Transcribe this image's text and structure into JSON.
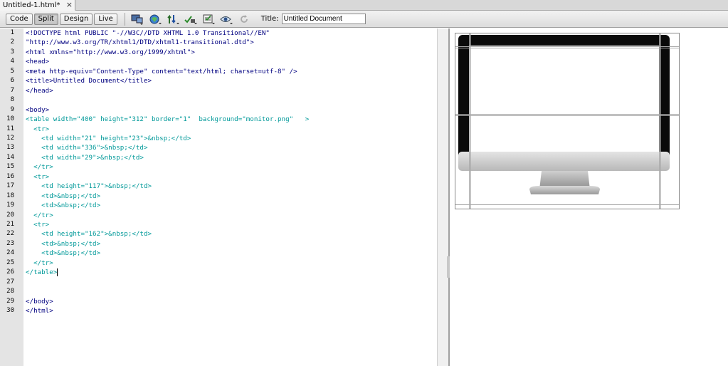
{
  "tab": {
    "label": "Untitled-1.html*",
    "close": "×"
  },
  "toolbar": {
    "views": [
      "Code",
      "Split",
      "Design",
      "Live"
    ],
    "active_view": "Split",
    "icons": [
      "multiscreen-icon",
      "preview-browser-icon",
      "file-management-icon",
      "w3c-validation-icon",
      "check-browser-compat-icon",
      "visual-aids-icon",
      "refresh-icon"
    ],
    "title_label": "Title:",
    "title_value": "Untitled Document"
  },
  "code": {
    "line_numbers": [
      "1",
      "2",
      "3",
      "4",
      "5",
      "6",
      "7",
      "8",
      "9",
      "10",
      "11",
      "12",
      "13",
      "14",
      "15",
      "16",
      "17",
      "18",
      "19",
      "20",
      "21",
      "22",
      "23",
      "24",
      "25",
      "26",
      "27",
      "28",
      "29",
      "30"
    ],
    "lines": [
      "<!DOCTYPE html PUBLIC \"-//W3C//DTD XHTML 1.0 Transitional//EN\"",
      "\"http://www.w3.org/TR/xhtml1/DTD/xhtml1-transitional.dtd\">",
      "<html xmlns=\"http://www.w3.org/1999/xhtml\">",
      "<head>",
      "<meta http-equiv=\"Content-Type\" content=\"text/html; charset=utf-8\" />",
      "<title>Untitled Document</title>",
      "</head>",
      "",
      "<body>",
      "<table width=\"400\" height=\"312\" border=\"1\"  background=\"monitor.png\"   >",
      "  <tr>",
      "    <td width=\"21\" height=\"23\">&nbsp;</td>",
      "    <td width=\"336\">&nbsp;</td>",
      "    <td width=\"29\">&nbsp;</td>",
      "  </tr>",
      "  <tr>",
      "    <td height=\"117\">&nbsp;</td>",
      "    <td>&nbsp;</td>",
      "    <td>&nbsp;</td>",
      "  </tr>",
      "  <tr>",
      "    <td height=\"162\">&nbsp;</td>",
      "    <td>&nbsp;</td>",
      "    <td>&nbsp;</td>",
      "  </tr>",
      "</table>",
      "",
      "",
      "</body>",
      "</html>"
    ],
    "table_line_indices": [
      9,
      10,
      11,
      12,
      13,
      14,
      15,
      16,
      17,
      18,
      19,
      20,
      21,
      22,
      23,
      24,
      25
    ]
  },
  "design": {
    "image_name": "monitor-image",
    "colors": {
      "bezel": "#0a0a0a",
      "screen": "#ffffff",
      "chin": "#d7d7d7",
      "stand": "#bdbdbd"
    }
  }
}
